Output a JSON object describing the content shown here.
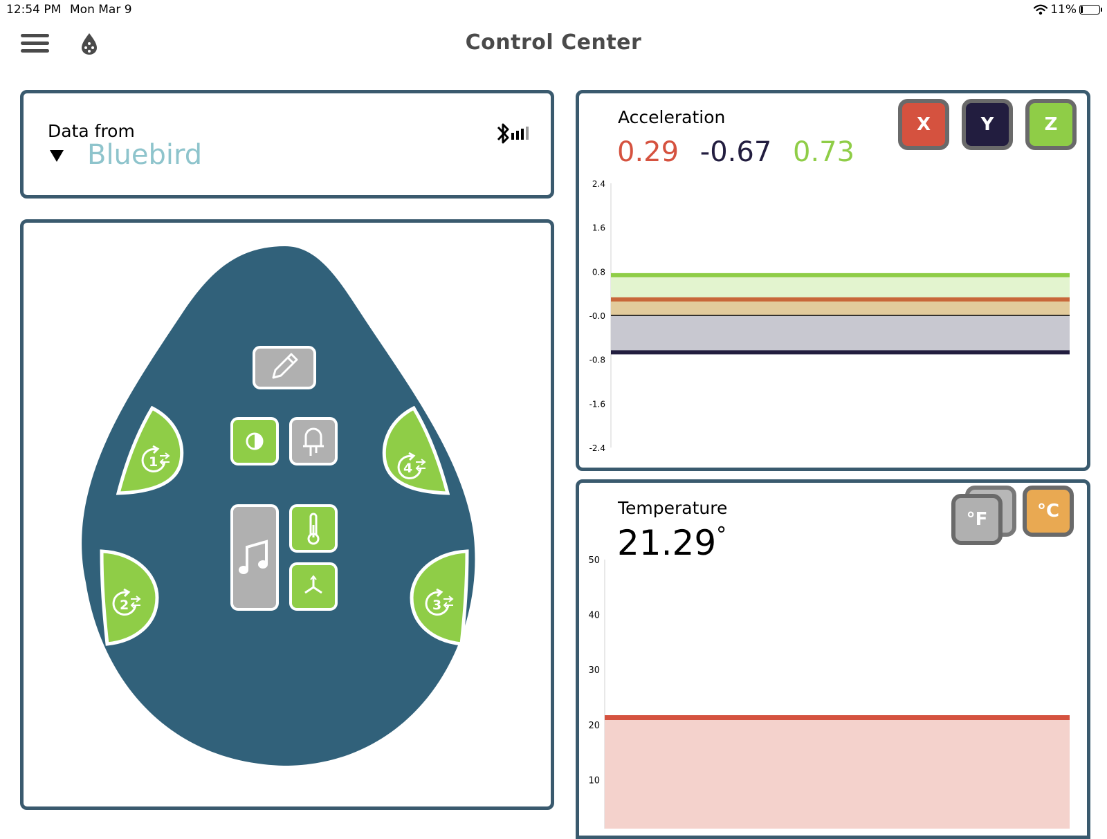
{
  "status_bar": {
    "time": "12:54 PM",
    "date": "Mon Mar 9",
    "battery": "11%"
  },
  "header": {
    "title": "Control Center",
    "menu_icon": "hamburger-icon",
    "logo_icon": "droplet-icon"
  },
  "device": {
    "label": "Data from",
    "name": "Bluebird",
    "connection_icon": "bluetooth-signal-icon"
  },
  "controls": {
    "ports": [
      {
        "id": "1",
        "label": "1"
      },
      {
        "id": "2",
        "label": "2"
      },
      {
        "id": "3",
        "label": "3"
      },
      {
        "id": "4",
        "label": "4"
      }
    ],
    "buttons": [
      "edit-icon",
      "light-sensor-icon",
      "led-icon",
      "music-icon",
      "temperature-icon",
      "accelerometer-icon"
    ]
  },
  "acceleration": {
    "title": "Acceleration",
    "x": "0.29",
    "y": "-0.67",
    "z": "0.73",
    "buttons": {
      "x": "X",
      "y": "Y",
      "z": "Z"
    }
  },
  "temperature": {
    "title": "Temperature",
    "value": "21.29",
    "degree": "°",
    "units": {
      "f": "°F",
      "c": "°C"
    }
  },
  "colors": {
    "x": "#d5523f",
    "y": "#221d3f",
    "z": "#8fcd47",
    "border": "#3a5a6e",
    "blob": "#31617a",
    "celsius": "#e9a952"
  },
  "chart_data": [
    {
      "type": "area",
      "title": "Acceleration",
      "ylim": [
        -2.4,
        2.4
      ],
      "ytick_labels": [
        "2.4",
        "1.6",
        "0.8",
        "-0.0",
        "-0.8",
        "-1.6",
        "-2.4"
      ],
      "series": [
        {
          "name": "X",
          "values": [
            0.29,
            0.29,
            0.29,
            0.29,
            0.29,
            0.29
          ]
        },
        {
          "name": "Y",
          "values": [
            -0.67,
            -0.67,
            -0.67,
            -0.67,
            -0.67,
            -0.67
          ]
        },
        {
          "name": "Z",
          "values": [
            0.73,
            0.73,
            0.73,
            0.73,
            0.73,
            0.73
          ]
        }
      ]
    },
    {
      "type": "area",
      "title": "Temperature",
      "ylim": [
        0,
        50
      ],
      "ytick_labels": [
        "50",
        "40",
        "30",
        "20",
        "10"
      ],
      "series": [
        {
          "name": "°C",
          "values": [
            21.29,
            21.29,
            21.29,
            21.29,
            21.29,
            21.29
          ]
        }
      ]
    }
  ]
}
